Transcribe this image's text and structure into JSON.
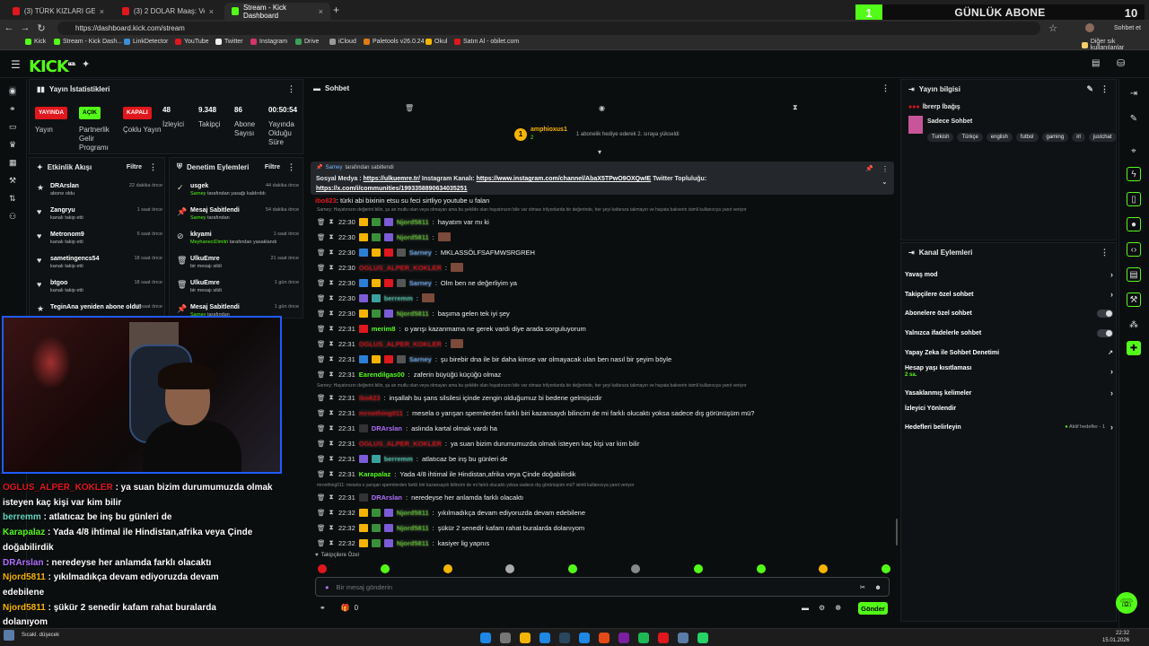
{
  "browser": {
    "tabs": [
      {
        "title": "(3) TÜRK KIZLARI GERÇEKTEN \"KI...",
        "active": false
      },
      {
        "title": "(3) 2 DOLAR Maaş: Venezuela'da İ...",
        "active": false
      },
      {
        "title": "Stream - Kick Dashboard",
        "active": true
      }
    ],
    "url": "https://dashboard.kick.com/stream",
    "bookmarks": [
      "Kick",
      "Stream - Kick Dash...",
      "LinkDetector",
      "YouTube",
      "Twitter",
      "Instagram",
      "Drive",
      "iCloud",
      "Paletools v26.0.24",
      "Okul",
      "Satın Al - obilet.com"
    ],
    "bookmarks_right": "Diğer sık kullanılanlar",
    "profile_label": "Sohbet et"
  },
  "overlay_banner": {
    "number_left": "1",
    "label": "GÜNLÜK ABONE",
    "number_right": "10"
  },
  "kick": {
    "logo": "KICK",
    "logo_beta": "BETA"
  },
  "stream_stats": {
    "title": "Yayın İstatistikleri",
    "badges": [
      {
        "text": "YAYINDA",
        "sub": "Yayın",
        "color": "#e0171d"
      },
      {
        "text": "AÇIK",
        "sub": "Partnerlik Gelir Programı",
        "color": "#53fc18"
      },
      {
        "text": "KAPALI",
        "sub": "Çoklu Yayın",
        "color": "#e0171d"
      }
    ],
    "numbers": [
      {
        "value": "48",
        "label": "İzleyici"
      },
      {
        "value": "9.348",
        "label": "Takipçi"
      },
      {
        "value": "86",
        "label": "Abone Sayısı"
      },
      {
        "value": "00:50:54",
        "label": "Yayında Olduğu Süre"
      }
    ]
  },
  "activity": {
    "title": "Etkinlik Akışı",
    "filter": "Filtre",
    "items": [
      {
        "name": "DRArslan",
        "desc": "abone oldu",
        "time": "22 dakika önce",
        "icon": "★"
      },
      {
        "name": "Zangryu",
        "desc": "kanalı takip etti",
        "time": "1 saat önce",
        "icon": "♥"
      },
      {
        "name": "Metronom9",
        "desc": "kanalı takip etti",
        "time": "6 saat önce",
        "icon": "♥"
      },
      {
        "name": "sametingencs54",
        "desc": "kanalı takip etti",
        "time": "18 saat önce",
        "icon": "♥"
      },
      {
        "name": "btgoo",
        "desc": "kanalı takip etti",
        "time": "18 saat önce",
        "icon": "♥"
      },
      {
        "name": "TeginAna yeniden abone oldu!",
        "desc": "",
        "time": "18 saat önce",
        "icon": "★"
      }
    ]
  },
  "moderation": {
    "title": "Denetim Eylemleri",
    "filter": "Filtre",
    "items": [
      {
        "name": "usgek",
        "desc_user": "Sarney",
        "desc": " tarafından yasağı kaldırıldı",
        "time": "44 dakika önce",
        "icon": "✓"
      },
      {
        "name": "Mesaj Sabitlendi",
        "desc_user": "Sarney",
        "desc": " tarafından",
        "time": "54 dakika önce",
        "icon": "📌"
      },
      {
        "name": "kkyami",
        "desc_user": "MeyhaneciDimitri",
        "desc": " tarafından yasaklandı",
        "time": "1 saat önce",
        "icon": "⊘"
      },
      {
        "name": "UlkuEmre",
        "desc_user": "",
        "desc": "bir mesajı sildi",
        "time": "21 saat önce",
        "icon": "🗑"
      },
      {
        "name": "UlkuEmre",
        "desc_user": "",
        "desc": "bir mesajı sildi",
        "time": "1 gün önce",
        "icon": "🗑"
      },
      {
        "name": "Mesaj Sabitlendi",
        "desc_user": "Sarney",
        "desc": " tarafından",
        "time": "1 gün önce",
        "icon": "📌"
      }
    ]
  },
  "chat": {
    "title": "Sohbet",
    "top_sub": {
      "name": "amphioxus1",
      "sub": "2",
      "text": "1 abonelik hediye ederek 2. sıraya yükseldi"
    },
    "pinned": {
      "by_user": "Sarney",
      "by_text": "tarafından sabitlendi",
      "line1_prefix": "Sosyal Medya : ",
      "link1": "https://ulkuemre.tr/",
      "line1_mid": " Instagram Kanalı: ",
      "link2": "https://www.instagram.com/channel/AbaX5TPwO9OXQwIE",
      "line1_suffix": " Twitter Topluluğu:",
      "link3": "https://x.com/i/communities/1993358890634035251"
    },
    "above_text": "türki abi bixinin etsu su feci sirtliyo youtube u falan",
    "above_user": "ibo823",
    "messages": [
      {
        "type": "reply",
        "text": "Sarney: Hayatınızın değerini bilin, şu an mutlu olan veya olmayan ama bu şekilde olan hayatınızın bile var olması trilyonlarda bir değerinde, her şeyi kafanıza takmayın ve hayata bakverin isimli kullanıcıya yanıt veriyor"
      },
      {
        "time": "22:30",
        "user": "Njord5811",
        "color": "#6fcf3f",
        "blur": true,
        "text": "hayatım var mı ki",
        "badges": [
          "#f5b400",
          "#3a8f3a",
          "#7b5cd6"
        ]
      },
      {
        "time": "22:30",
        "user": "Njord5811",
        "color": "#6fcf3f",
        "blur": true,
        "text": "",
        "badges": [
          "#f5b400",
          "#3a8f3a",
          "#7b5cd6"
        ],
        "emote": true
      },
      {
        "time": "22:30",
        "user": "Sarney",
        "color": "#7ab8ff",
        "blur": true,
        "text": "MKLASSÖLFSAFMWSRGREH",
        "badges": [
          "#2d7fd6",
          "#f5b400",
          "#e0171d",
          "#555"
        ]
      },
      {
        "time": "22:30",
        "user": "OGLUS_ALPER_KOKLER",
        "color": "#e0171d",
        "blur": true,
        "text": "",
        "badges": [],
        "emote": true
      },
      {
        "time": "22:30",
        "user": "Sarney",
        "color": "#7ab8ff",
        "blur": true,
        "text": "Olm ben ne değerliyim ya",
        "badges": [
          "#2d7fd6",
          "#f5b400",
          "#e0171d",
          "#555"
        ]
      },
      {
        "time": "22:30",
        "user": "berremm",
        "color": "#5fd6c0",
        "blur": true,
        "text": "",
        "badges": [
          "#7b5cd6",
          "#3aa0a0"
        ],
        "emote": true
      },
      {
        "time": "22:30",
        "user": "Njord5811",
        "color": "#6fcf3f",
        "blur": true,
        "text": "başıma gelen tek iyi şey",
        "badges": [
          "#f5b400",
          "#3a8f3a",
          "#7b5cd6"
        ]
      },
      {
        "time": "22:31",
        "user": "merim8",
        "color": "#53fc18",
        "blur": false,
        "text": "o yarışı kazanmama ne gerek vardı diye arada sorguluyorum",
        "badges": [
          "#e0171d"
        ]
      },
      {
        "time": "22:31",
        "user": "OGLUS_ALPER_KOKLER",
        "color": "#e0171d",
        "blur": true,
        "text": "",
        "badges": [],
        "emote": true
      },
      {
        "time": "22:31",
        "user": "Sarney",
        "color": "#7ab8ff",
        "blur": true,
        "text": "şu birebir dna ile bir daha kimse var olmayacak ulan ben nasıl bir şeyim böyle",
        "badges": [
          "#2d7fd6",
          "#f5b400",
          "#e0171d",
          "#555"
        ]
      },
      {
        "time": "22:31",
        "user": "Earendilgas00",
        "color": "#53fc18",
        "blur": false,
        "text": "zaferin büyüğü küçüğü olmaz",
        "badges": []
      },
      {
        "type": "reply",
        "text": "Sarney: Hayatınızın değerini bilin, şu an mutlu olan veya olmayan ama bu şekilde olan hayatınızın bile var olması trilyonlarda bir değerinde, her şeyi kafanıza takmayın ve hayata bakverin isimli kullanıcıya yanıt veriyor"
      },
      {
        "time": "22:31",
        "user": "ibo823",
        "color": "#e0171d",
        "blur": true,
        "text": "inşallah bu şans silsilesi içinde zengin olduğumuz bi bedene gelmişizdir",
        "badges": []
      },
      {
        "time": "22:31",
        "user": "mrnothing011",
        "color": "#e0171d",
        "blur": true,
        "text": "mesela o yarışan spermlerden farklı biri kazansaydı bilincim de mi farklı olucaktı yoksa sadece dış görünüşüm mü?",
        "badges": []
      },
      {
        "time": "22:31",
        "user": "DRArslan",
        "color": "#b070ff",
        "blur": false,
        "text": "aslında kartal olmak vardı ha",
        "badges": [
          "#333"
        ]
      },
      {
        "time": "22:31",
        "user": "OGLUS_ALPER_KOKLER",
        "color": "#e0171d",
        "blur": true,
        "text": "ya suan bizim durumumuzda olmak isteyen kaç kişi var kim bilir",
        "badges": []
      },
      {
        "time": "22:31",
        "user": "berremm",
        "color": "#5fd6c0",
        "blur": true,
        "text": "atlatıcaz be inş bu günleri de",
        "badges": [
          "#7b5cd6",
          "#3aa0a0"
        ]
      },
      {
        "time": "22:31",
        "user": "Karapalaz",
        "color": "#53fc18",
        "blur": false,
        "text": "Yada 4/8 ihtimal ile Hindistan,afrika veya Çinde doğabilirdik",
        "badges": []
      },
      {
        "type": "reply",
        "text": "mrnothing011: mesela o yarışan spermlerden farklı biri kazansaydı bilincim de mi farklı olucaktı yoksa sadece dış görünüşüm mü? isimli kullanıcıya yanıt veriyor"
      },
      {
        "time": "22:31",
        "user": "DRArslan",
        "color": "#b070ff",
        "blur": false,
        "text": "neredeyse her anlamda farklı olacaktı",
        "badges": [
          "#333"
        ]
      },
      {
        "time": "22:32",
        "user": "Njord5811",
        "color": "#6fcf3f",
        "blur": true,
        "text": "yıkılmadıkça devam ediyoruzda devam edebilene",
        "badges": [
          "#f5b400",
          "#3a8f3a",
          "#7b5cd6"
        ]
      },
      {
        "time": "22:32",
        "user": "Njord5811",
        "color": "#6fcf3f",
        "blur": true,
        "text": "şükür 2 senedir kafam rahat buralarda dolanıyom",
        "badges": [
          "#f5b400",
          "#3a8f3a",
          "#7b5cd6"
        ]
      },
      {
        "time": "22:32",
        "user": "Njord5811",
        "color": "#6fcf3f",
        "blur": true,
        "text": "kasiyer lig yapnıs",
        "badges": [
          "#f5b400",
          "#3a8f3a",
          "#7b5cd6"
        ]
      }
    ],
    "followers_only": "Takipçilere Özel",
    "input_placeholder": "Bir mesaj gönderin",
    "count": "0",
    "send": "Gönder"
  },
  "stream_info": {
    "title": "Yayın bilgisi",
    "stream_title": "İbrerp İbağış",
    "category": "Sadece Sohbet",
    "tags": [
      "Turkish",
      "Türkçe",
      "english",
      "futbol",
      "gaming",
      "irl",
      "justchat"
    ]
  },
  "channel_actions": {
    "title": "Kanal Eylemleri",
    "rows": [
      {
        "label": "Yavaş mod",
        "kind": "arrow"
      },
      {
        "label": "Takipçilere özel sohbet",
        "kind": "arrow"
      },
      {
        "label": "Abonelere özel sohbet",
        "kind": "toggle"
      },
      {
        "label": "Yalnızca ifadelerle sohbet",
        "kind": "toggle"
      },
      {
        "label": "Yapay Zeka ile Sohbet Denetimi",
        "kind": "external"
      },
      {
        "label": "Hesap yaşı kısıtlaması",
        "kind": "arrow",
        "sub": "2 sa."
      },
      {
        "label": "Yasaklanmış kelimeler",
        "kind": "arrow"
      },
      {
        "label": "İzleyici Yönlendir",
        "kind": "none"
      },
      {
        "label": "Hedefleri belirleyin",
        "kind": "arrow",
        "extra": "Aktif hedefler - 1"
      }
    ]
  },
  "left_overlay": [
    {
      "user": "OGLUS_ALPER_KOKLER",
      "color": "#e0171d",
      "text": " : ya suan bizim durumumuzda olmak"
    },
    {
      "user": "",
      "color": "#fff",
      "text": "isteyen kaç kişi var kim bilir"
    },
    {
      "user": "berremm",
      "color": "#5fd6c0",
      "text": " : atlatıcaz be inş bu günleri de"
    },
    {
      "user": "Karapalaz",
      "color": "#53fc18",
      "text": " : Yada 4/8 ihtimal ile Hindistan,afrika veya Çinde"
    },
    {
      "user": "",
      "color": "#fff",
      "text": "doğabilirdik"
    },
    {
      "user": "DRArslan",
      "color": "#b070ff",
      "text": " : neredeyse her anlamda farklı olacaktı"
    },
    {
      "user": "Njord5811",
      "color": "#f5b400",
      "text": " : yıkılmadıkça devam ediyoruzda devam"
    },
    {
      "user": "",
      "color": "#fff",
      "text": "edebilene"
    },
    {
      "user": "Njord5811",
      "color": "#f5b400",
      "text": " : şükür 2 senedir kafam rahat buralarda"
    },
    {
      "user": "",
      "color": "#fff",
      "text": "dolanıyom"
    },
    {
      "user": "Njord5811",
      "color": "#f5b400",
      "text": " : kasiyer lig yapnıs"
    }
  ],
  "taskbar": {
    "time": "22:32",
    "date": "15.01.2026",
    "weather": "Sıcakl. düşecek"
  }
}
